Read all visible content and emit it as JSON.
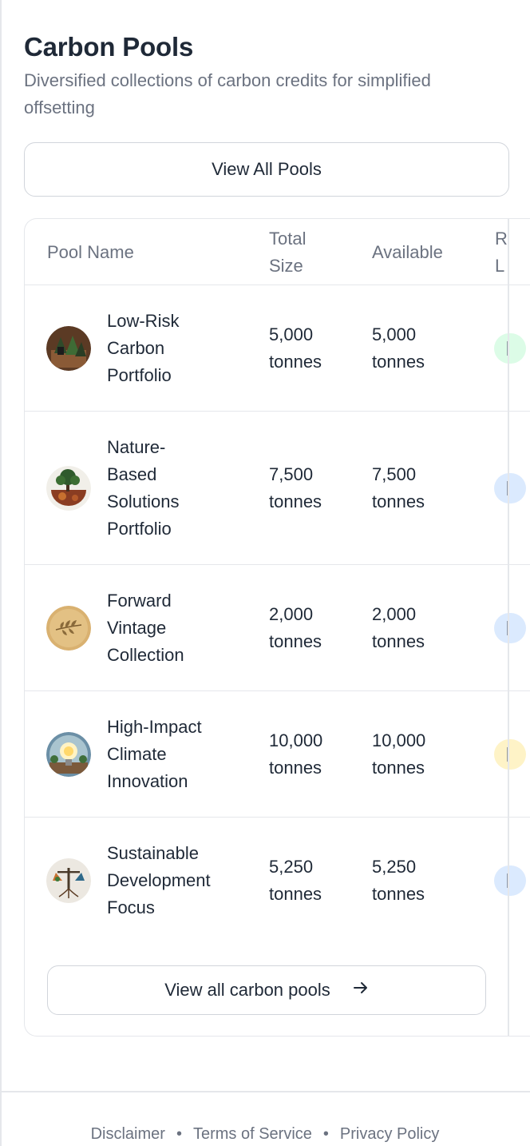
{
  "header": {
    "title": "Carbon Pools",
    "subtitle": "Diversified collections of carbon credits for simplified offsetting",
    "view_all_label": "View All Pools"
  },
  "table": {
    "columns": {
      "pool_name": "Pool Name",
      "total_size_l1": "Total",
      "total_size_l2": "Size",
      "available": "Available",
      "risk_l1": "R",
      "risk_l2": "L"
    },
    "rows": [
      {
        "name_lines": [
          "Low-Risk",
          "Carbon",
          "Portfolio"
        ],
        "total_value": "5,000",
        "total_unit": "tonnes",
        "available_value": "5,000",
        "available_unit": "tonnes",
        "pill_color": "#dcfce7",
        "icon": "forest-icon"
      },
      {
        "name_lines": [
          "Nature-",
          "Based",
          "Solutions",
          "Portfolio"
        ],
        "total_value": "7,500",
        "total_unit": "tonnes",
        "available_value": "7,500",
        "available_unit": "tonnes",
        "pill_color": "#dbeafe",
        "icon": "tree-globe-icon"
      },
      {
        "name_lines": [
          "Forward",
          "Vintage",
          "Collection"
        ],
        "total_value": "2,000",
        "total_unit": "tonnes",
        "available_value": "2,000",
        "available_unit": "tonnes",
        "pill_color": "#dbeafe",
        "icon": "leaf-icon"
      },
      {
        "name_lines": [
          "High-Impact",
          "Climate",
          "Innovation"
        ],
        "total_value": "10,000",
        "total_unit": "tonnes",
        "available_value": "10,000",
        "available_unit": "tonnes",
        "pill_color": "#fef3c7",
        "icon": "lightbulb-icon"
      },
      {
        "name_lines": [
          "Sustainable",
          "Development",
          "Focus"
        ],
        "total_value": "5,250",
        "total_unit": "tonnes",
        "available_value": "5,250",
        "available_unit": "tonnes",
        "pill_color": "#dbeafe",
        "icon": "balance-scale-icon"
      }
    ],
    "view_all_link_label": "View all carbon pools",
    "view_all_link_icon": "arrow-right-icon"
  },
  "footer": {
    "links": [
      "Disclaimer",
      "Terms of Service",
      "Privacy Policy"
    ],
    "separator": "•"
  }
}
